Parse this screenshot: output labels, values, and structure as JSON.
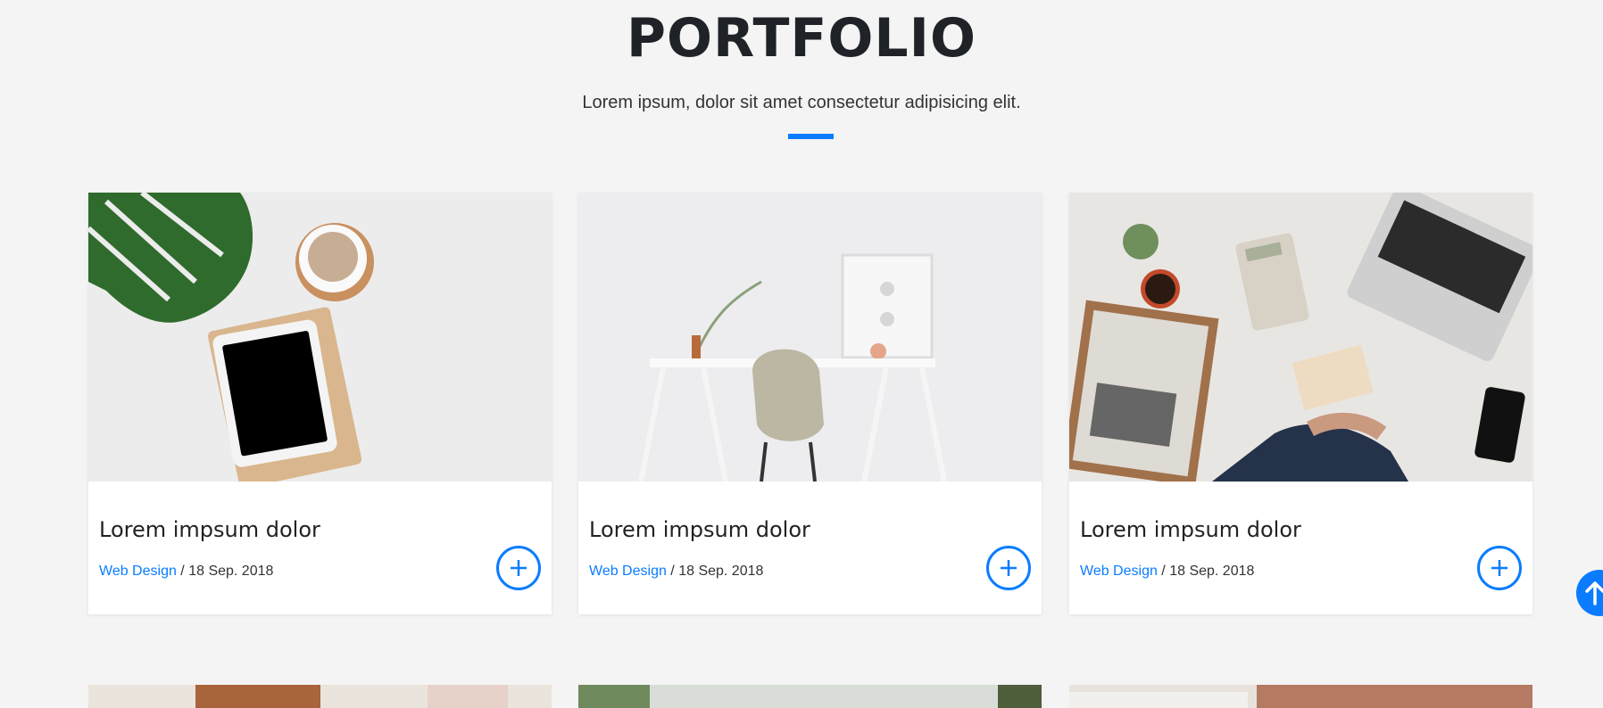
{
  "header": {
    "title": "PORTFOLIO",
    "subtitle": "Lorem ipsum, dolor sit amet consectetur adipisicing elit."
  },
  "colors": {
    "accent": "#0b7cff",
    "background": "#f4f4f4"
  },
  "cards": [
    {
      "title": "Lorem impsum dolor",
      "category": "Web Design",
      "separator": " / ",
      "date": "18 Sep. 2018",
      "image": "workspace-plant-tablet-coffee",
      "action_icon": "plus-icon"
    },
    {
      "title": "Lorem impsum dolor",
      "category": "Web Design",
      "separator": " / ",
      "date": "18 Sep. 2018",
      "image": "desk-chair-frame",
      "action_icon": "plus-icon"
    },
    {
      "title": "Lorem impsum dolor",
      "category": "Web Design",
      "separator": " / ",
      "date": "18 Sep. 2018",
      "image": "business-desk-laptop-calculator",
      "action_icon": "plus-icon"
    }
  ],
  "scroll_top": {
    "icon": "arrow-up-icon"
  }
}
